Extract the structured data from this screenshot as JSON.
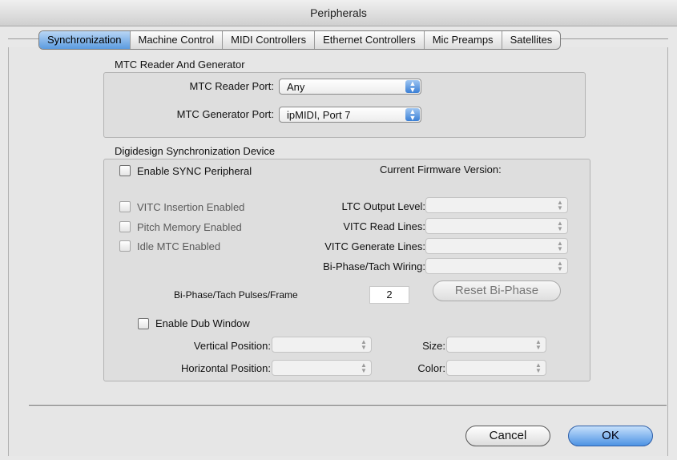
{
  "window": {
    "title": "Peripherals"
  },
  "tabs": [
    {
      "label": "Synchronization",
      "active": true
    },
    {
      "label": "Machine Control",
      "active": false
    },
    {
      "label": "MIDI Controllers",
      "active": false
    },
    {
      "label": "Ethernet Controllers",
      "active": false
    },
    {
      "label": "Mic Preamps",
      "active": false
    },
    {
      "label": "Satellites",
      "active": false
    }
  ],
  "mtc": {
    "group_title": "MTC Reader And Generator",
    "reader_label": "MTC Reader Port:",
    "reader_value": "Any",
    "generator_label": "MTC Generator Port:",
    "generator_value": "ipMIDI, Port 7"
  },
  "sync": {
    "group_title": "Digidesign Synchronization Device",
    "enable_label": "Enable SYNC Peripheral",
    "firmware_label": "Current Firmware Version:",
    "vitc_insertion_label": "VITC Insertion Enabled",
    "pitch_memory_label": "Pitch Memory Enabled",
    "idle_mtc_label": "Idle MTC Enabled",
    "ltc_output_label": "LTC Output Level:",
    "vitc_read_label": "VITC Read Lines:",
    "vitc_generate_label": "VITC Generate Lines:",
    "biphase_wiring_label": "Bi-Phase/Tach Wiring:",
    "pulses_label": "Bi-Phase/Tach Pulses/Frame",
    "pulses_value": "2",
    "reset_label": "Reset Bi-Phase",
    "dub_label": "Enable Dub Window",
    "vertical_label": "Vertical Position:",
    "horizontal_label": "Horizontal Position:",
    "size_label": "Size:",
    "color_label": "Color:"
  },
  "buttons": {
    "cancel": "Cancel",
    "ok": "OK"
  },
  "colors": {
    "accent": "#4e93e4",
    "tab_active": "#5b9be0"
  },
  "icons": {
    "select_arrows": "updown-arrows-icon"
  }
}
